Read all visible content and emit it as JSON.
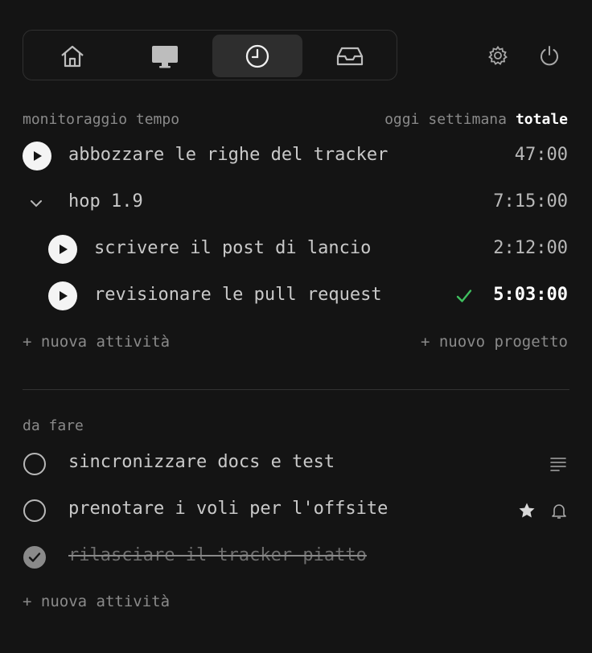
{
  "nav": {
    "tabs": [
      {
        "icon": "home-icon",
        "active": false
      },
      {
        "icon": "monitor-icon",
        "active": false
      },
      {
        "icon": "clock-icon",
        "active": true
      },
      {
        "icon": "inbox-icon",
        "active": false
      }
    ],
    "settings_icon": "gear-icon",
    "power_icon": "power-icon"
  },
  "time_tracking": {
    "title": "monitoraggio tempo",
    "filters": [
      "oggi",
      "settimana",
      "totale"
    ],
    "selected_filter": "totale",
    "tasks": [
      {
        "name": "abbozzare le righe del tracker",
        "time": "47:00"
      },
      {
        "name": "hop 1.9",
        "time": "7:15:00",
        "is_project": true,
        "expanded": true
      },
      {
        "name": "scrivere il post di lancio",
        "time": "2:12:00"
      },
      {
        "name": "revisionare le pull request",
        "time": "5:03:00",
        "completed": true
      }
    ],
    "new_task": "+ nuova attività",
    "new_project": "+ nuovo progetto"
  },
  "todo": {
    "title": "da fare",
    "items": [
      {
        "text": "sincronizzare docs e test",
        "done": false,
        "icons": [
          "notes-icon"
        ]
      },
      {
        "text": "prenotare i voli per l'offsite",
        "done": false,
        "icons": [
          "star-icon",
          "bell-icon"
        ]
      },
      {
        "text": "rilasciare il tracker piatto",
        "done": true,
        "icons": []
      }
    ],
    "new_task": "+ nuova attività"
  },
  "colors": {
    "background": "#141414",
    "accent_green": "#3fbf5f",
    "text": "#c9c9c9",
    "muted": "#8a8a8a"
  }
}
